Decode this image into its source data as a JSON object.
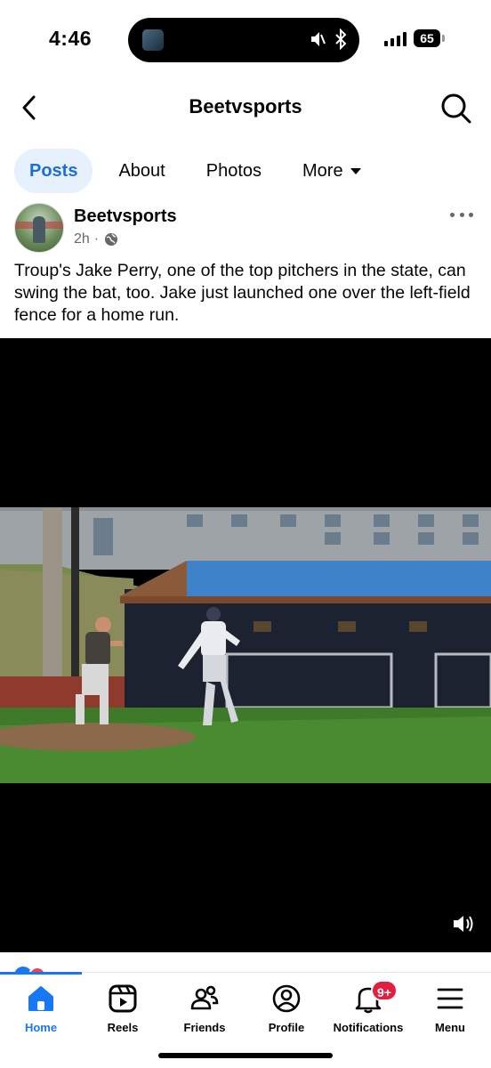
{
  "status_bar": {
    "time": "4:46",
    "battery": "65",
    "icons": [
      "now-playing-thumbnail",
      "mute-icon",
      "bluetooth-icon",
      "signal-icon",
      "battery-icon"
    ]
  },
  "header": {
    "title": "Beetvsports",
    "back_icon": "chevron-left-icon",
    "search_icon": "search-icon"
  },
  "tabs": [
    {
      "label": "Posts",
      "active": true
    },
    {
      "label": "About",
      "active": false
    },
    {
      "label": "Photos",
      "active": false
    },
    {
      "label": "More",
      "active": false
    }
  ],
  "post": {
    "author": "Beetvsports",
    "time": "2h",
    "separator": "·",
    "audience_icon": "globe-icon",
    "text": "Troup's Jake Perry, one of the top pitchers in the state, can swing the bat, too. Jake just launched one over the left-field fence for a home run."
  },
  "video": {
    "sound_icon": "speaker-icon"
  },
  "bottom_nav": {
    "items": [
      {
        "label": "Home",
        "icon": "home-icon",
        "active": true
      },
      {
        "label": "Reels",
        "icon": "reels-icon",
        "active": false
      },
      {
        "label": "Friends",
        "icon": "friends-icon",
        "active": false
      },
      {
        "label": "Profile",
        "icon": "profile-icon",
        "active": false
      },
      {
        "label": "Notifications",
        "icon": "bell-icon",
        "active": false,
        "badge": "9+"
      },
      {
        "label": "Menu",
        "icon": "hamburger-menu-icon",
        "active": false
      }
    ]
  },
  "colors": {
    "accent": "#1877f2",
    "active_tab_bg": "#e7f1fd",
    "badge": "#e41e3f",
    "secondary_text": "#65676b"
  }
}
